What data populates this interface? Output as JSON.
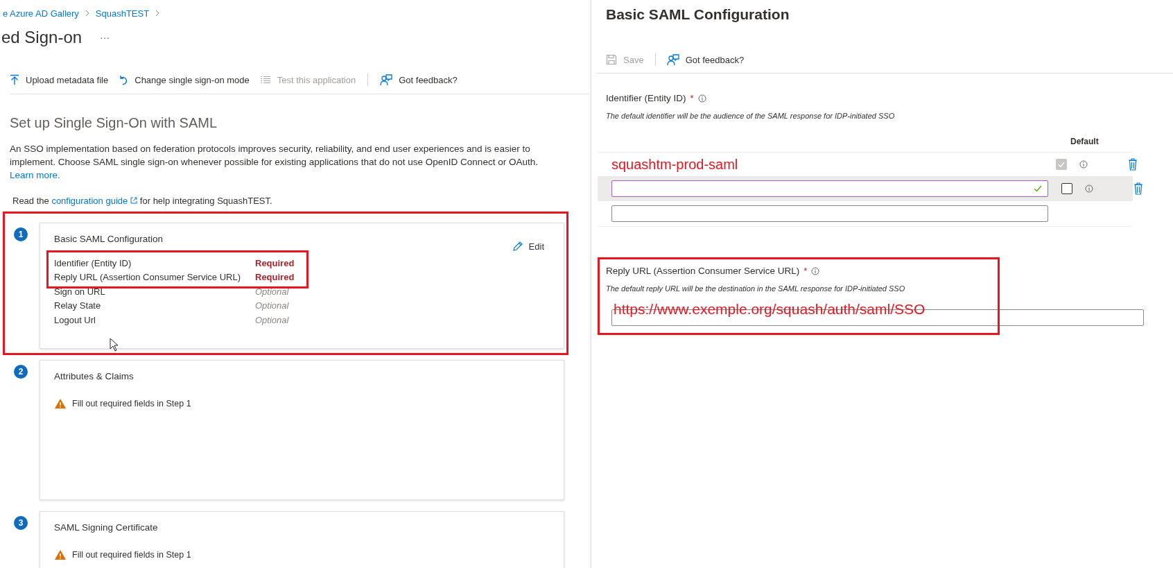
{
  "breadcrumb": [
    {
      "label": "e Azure AD Gallery"
    },
    {
      "label": "SquashTEST"
    }
  ],
  "page_title": "ed Sign-on",
  "more_menu": "···",
  "toolbar": [
    {
      "label": "Upload metadata file",
      "kind": "upload",
      "disabled": false
    },
    {
      "label": "Change single sign-on mode",
      "kind": "undo",
      "disabled": false
    },
    {
      "label": "Test this application",
      "kind": "list",
      "disabled": true
    },
    {
      "label": "Got feedback?",
      "kind": "feedback",
      "disabled": false
    }
  ],
  "section_title": "Set up Single Sign-On with SAML",
  "description": "An SSO implementation based on federation protocols improves security, reliability, and end user experiences and is easier to implement. Choose SAML single sign-on whenever possible for existing applications that do not use OpenID Connect or OAuth.",
  "learn_more": "Learn more.",
  "guide": {
    "before": "Read the",
    "link": "configuration guide",
    "after": "for help integrating SquashTEST."
  },
  "steps": [
    {
      "number": "1",
      "title": "Basic SAML Configuration",
      "edit": "Edit",
      "highlight": true,
      "fields": [
        {
          "label": "Identifier (Entity ID)",
          "status": "Required",
          "required": true,
          "highlight": true
        },
        {
          "label": "Reply URL (Assertion Consumer Service URL)",
          "status": "Required",
          "required": true,
          "highlight": true
        },
        {
          "label": "Sign on URL",
          "status": "Optional",
          "required": false,
          "highlight": false
        },
        {
          "label": "Relay State",
          "status": "Optional",
          "required": false,
          "highlight": false
        },
        {
          "label": "Logout Url",
          "status": "Optional",
          "required": false,
          "highlight": false
        }
      ]
    },
    {
      "number": "2",
      "title": "Attributes & Claims",
      "highlight": false,
      "warning": "Fill out required fields in Step 1"
    },
    {
      "number": "3",
      "title": "SAML Signing Certificate",
      "highlight": false,
      "warning": "Fill out required fields in Step 1"
    }
  ],
  "panel": {
    "title": "Basic SAML Configuration",
    "toolbar": [
      {
        "label": "Save",
        "kind": "save",
        "disabled": true
      },
      {
        "label": "Got feedback?",
        "kind": "feedback",
        "disabled": false
      }
    ],
    "identifier": {
      "label": "Identifier (Entity ID)",
      "required_mark": "*",
      "hint": "The default identifier will be the audience of the SAML response for IDP-initiated SSO",
      "default_header": "Default",
      "rows": [
        {
          "kind": "entry",
          "value": "squashtm-prod-saml",
          "default": true,
          "focused": false
        },
        {
          "kind": "entry",
          "default": false,
          "focused": true
        },
        {
          "kind": "new"
        }
      ]
    },
    "reply_url": {
      "label": "Reply URL (Assertion Consumer Service URL)",
      "required_mark": "*",
      "highlight": true,
      "hint": "The default reply URL will be the destination in the SAML response for IDP-initiated SSO",
      "value": "https://www.exemple.org/squash/auth/saml/SSO"
    }
  }
}
